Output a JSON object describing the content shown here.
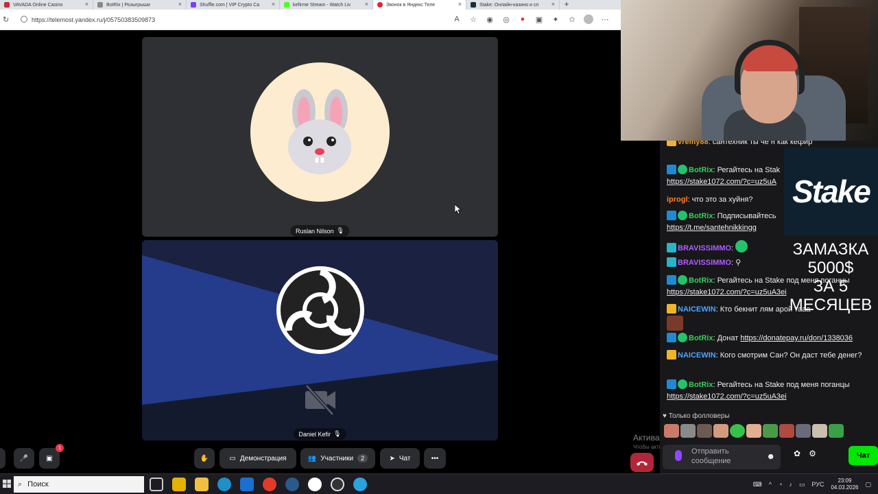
{
  "browser": {
    "tabs": [
      {
        "title": "VAVADA Online Casino",
        "color": "#c62c3a",
        "active": false
      },
      {
        "title": "BotRix | Розыгрыши",
        "color": "#888888",
        "active": false
      },
      {
        "title": "Shuffle.com | VIP Crypto Ca",
        "color": "#7a3cff",
        "active": false
      },
      {
        "title": "kefirme Stream - Watch Liv",
        "color": "#53fc18",
        "active": false
      },
      {
        "title": "Звонок в Яндекс Теле",
        "color": "#e0263b",
        "active": true
      },
      {
        "title": "Stake: Онлайн-казино и сп",
        "color": "#1a2c38",
        "active": false
      }
    ],
    "url": "https://telemost.yandex.ru/j/05750383509873"
  },
  "meeting": {
    "participants": [
      {
        "name": "Ruslan Nilson"
      },
      {
        "name": "Daniel Kefir"
      }
    ],
    "controls": {
      "notification_count": "1",
      "screen_share_label": "Демонстрация",
      "participants_label": "Участники",
      "participants_count": "2",
      "chat_label": "Чат"
    }
  },
  "windows_activation": {
    "title": "Активация Windows",
    "subtitle": "Чтобы активировать Windows, перейдите в раздел \"Параметры\"."
  },
  "chat": {
    "messages": [
      {
        "user": "vremy88",
        "user_color": "#f0a020",
        "text": "сантехник ты че н как кефир",
        "link": ""
      },
      {
        "user": "BotRix",
        "user_color": "#34d058",
        "text": "Регайтесь на Stak",
        "link": "https://stake1072.com/?c=uz5uA"
      },
      {
        "user": "iprogl",
        "user_color": "#ff7f27",
        "text": "что это за хуйня?",
        "link": ""
      },
      {
        "user": "BotRix",
        "user_color": "#34d058",
        "text": "Подписывайтесь",
        "link": "https://t.me/santehnikkingg"
      },
      {
        "user": "BRAVISSIMMO",
        "user_color": "#b05cff",
        "text": "",
        "link": ""
      },
      {
        "user": "BRAVISSIMMO",
        "user_color": "#b05cff",
        "text": "",
        "link": ""
      },
      {
        "user": "BotRix",
        "user_color": "#34d058",
        "text": "Регайтесь на Stake под меня поганцы",
        "link": "https://stake1072.com/?c=uz5uA3ei"
      },
      {
        "user": "NAICEWIN",
        "user_color": "#4fa3ff",
        "text": "Кто бекнит лям арой тааа",
        "link": ""
      },
      {
        "user": "BotRix",
        "user_color": "#34d058",
        "text": "Донат",
        "link": "https://donatepay.ru/don/1338036"
      },
      {
        "user": "NAICEWIN",
        "user_color": "#4fa3ff",
        "text": "Кого смотрим Сан? Он даст тебе денег?",
        "link": ""
      },
      {
        "user": "BotRix",
        "user_color": "#34d058",
        "text": "Регайтесь на Stake под меня поганцы",
        "link": "https://stake1072.com/?c=uz5uA3ei"
      }
    ],
    "followers_only": "Только фолловеры",
    "input_placeholder_line1": "Отправить",
    "input_placeholder_line2": "сообщение",
    "send_label": "Чат"
  },
  "overlay": {
    "stake_logo": "Stake",
    "promo_line1": "ЗАМАЗКА",
    "promo_line2": "5000$",
    "promo_line3": "ЗА 5",
    "promo_line4": "МЕСЯЦЕВ"
  },
  "taskbar": {
    "search_placeholder": "Поиск",
    "lang": "РУС",
    "time": "23:09",
    "date": "04.03.2026"
  }
}
